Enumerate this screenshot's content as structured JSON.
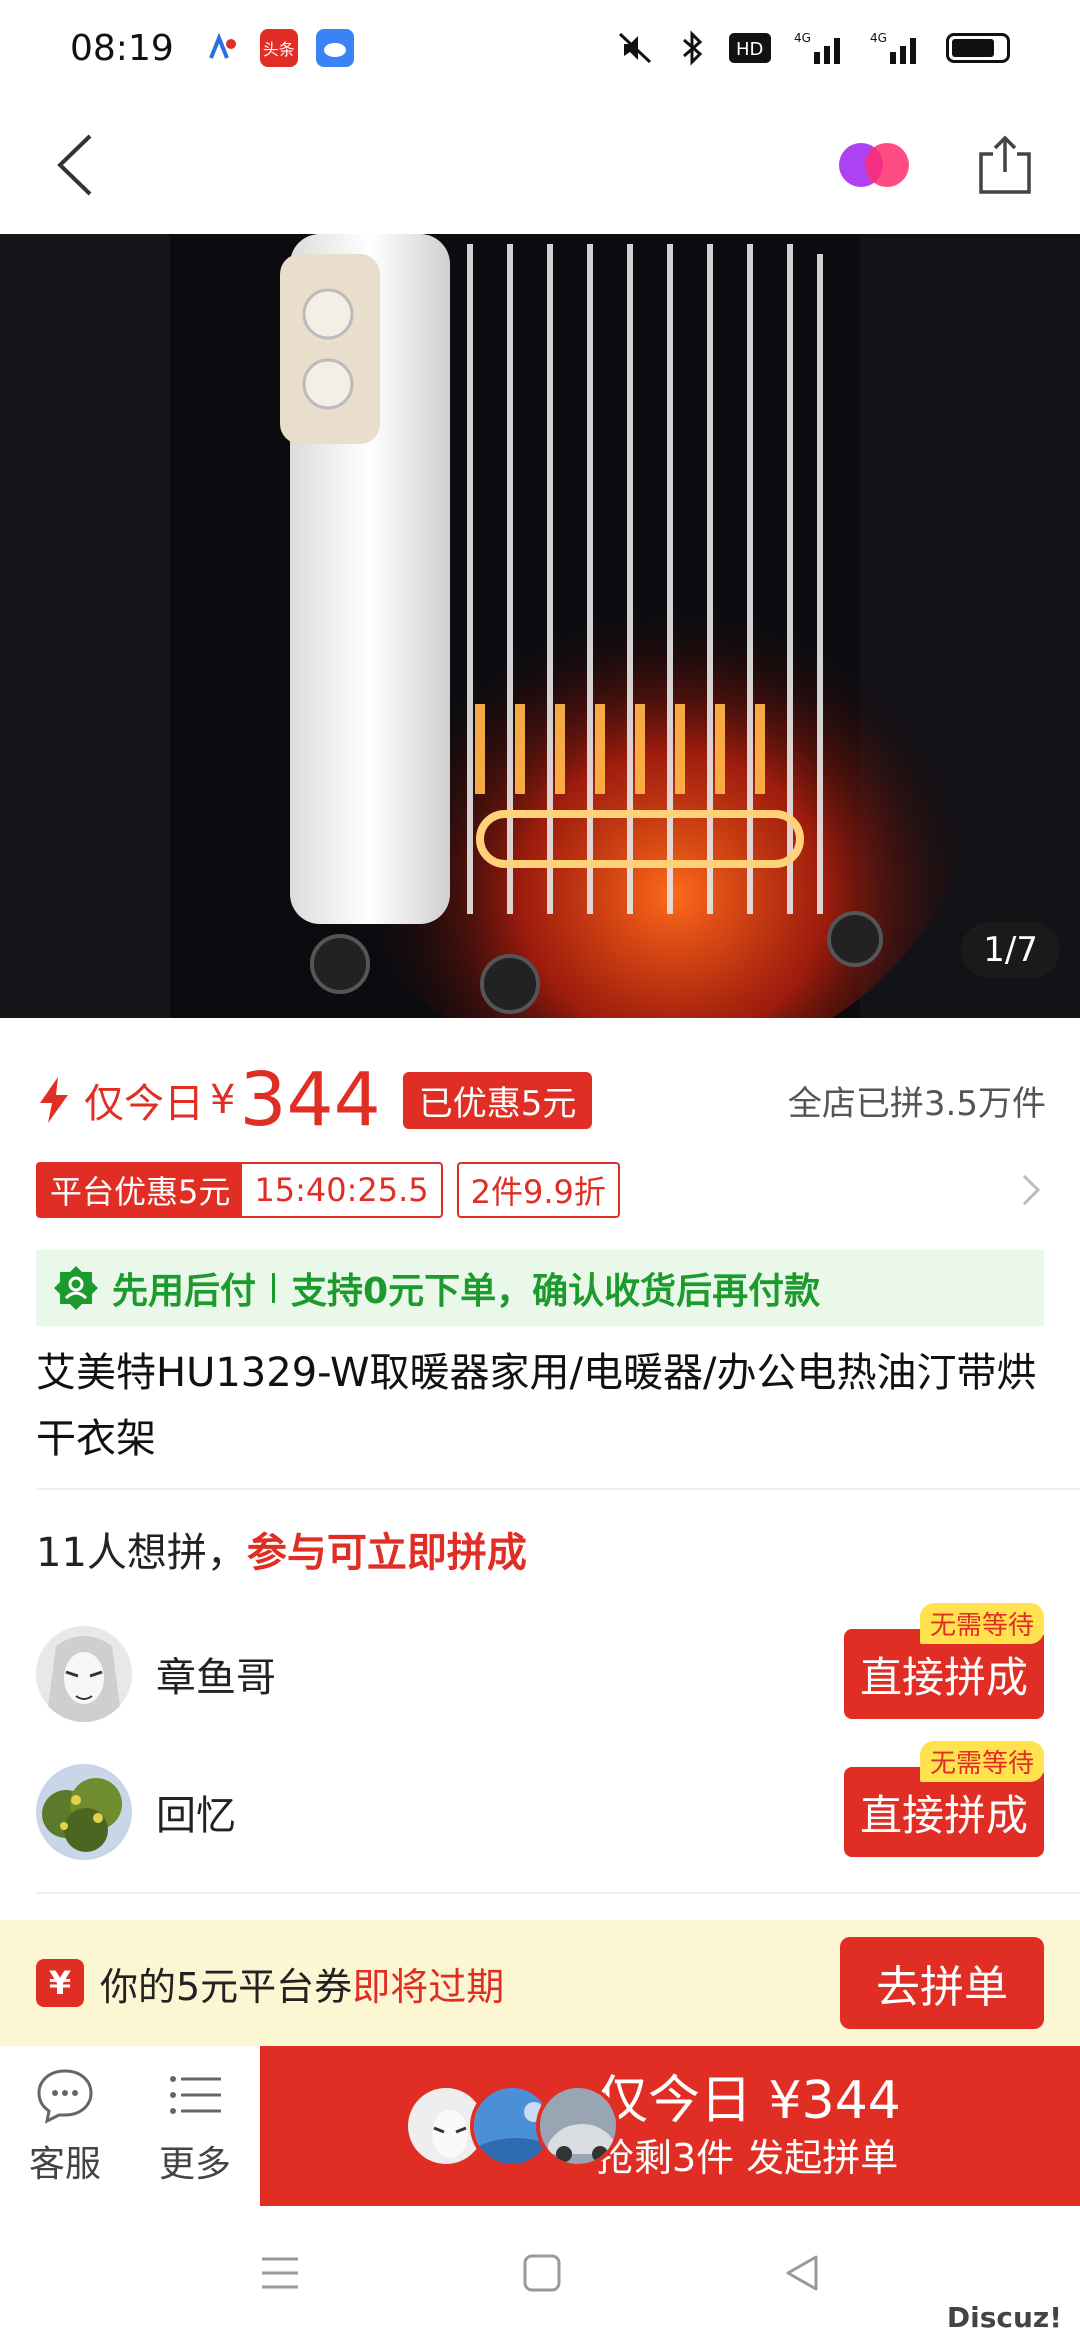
{
  "status": {
    "time": "08:19",
    "apps": [
      "云闪付",
      "头条",
      "云"
    ],
    "indicators": [
      "mute",
      "bluetooth",
      "HD",
      "4G",
      "4G"
    ]
  },
  "nav": {
    "back_icon": "back-arrow-icon",
    "share_icon": "share-icon"
  },
  "hero": {
    "image_desc": "oil-filled radiator heater",
    "page_indicator": "1/7"
  },
  "price": {
    "today_label": "仅今日",
    "currency": "¥",
    "amount": "344",
    "discount_tag": "已优惠5元",
    "group_count": "全店已拼3.5万件"
  },
  "promo": {
    "platform_label": "平台优惠5元",
    "timer": "15:40:25.5",
    "multi_deal": "2件9.9折"
  },
  "paylater": {
    "title": "先用后付",
    "desc": "支持0元下单，确认收货后再付款"
  },
  "product": {
    "title": "艾美特HU1329-W取暖器家用/电暖器/办公电热油汀带烘干衣架"
  },
  "group": {
    "want_count": "11人想拼，",
    "want_hl": "参与可立即拼成",
    "rows": [
      {
        "name": "章鱼哥",
        "badge": "无需等待",
        "button": "直接拼成"
      },
      {
        "name": "回忆",
        "badge": "无需等待",
        "button": "直接拼成"
      }
    ]
  },
  "coupon": {
    "icon": "¥",
    "text": "你的5元平台券",
    "highlight": "即将过期",
    "button": "去拼单"
  },
  "bottom": {
    "service_label": "客服",
    "more_label": "更多",
    "buy_main": "仅今日 ¥344",
    "buy_sub": "抢剩3件 发起拼单"
  },
  "watermark": "Discuz!",
  "colors": {
    "accent": "#e02e24",
    "green": "#1d9a2e",
    "coupon_bg": "#fdf6d3",
    "paylater_bg": "#e9f8e9"
  }
}
